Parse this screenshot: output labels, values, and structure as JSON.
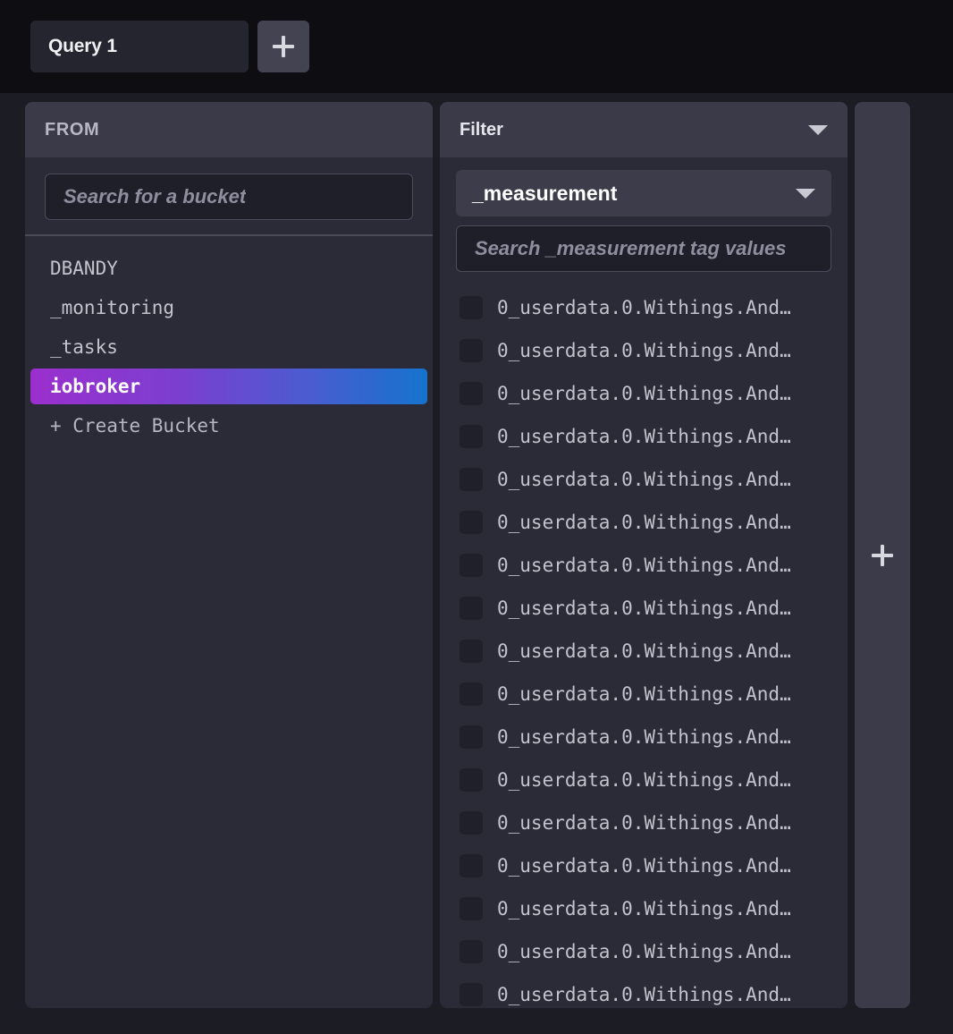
{
  "tabbar": {
    "query_tab_label": "Query 1",
    "add_query_icon": "plus-icon"
  },
  "from_panel": {
    "title": "FROM",
    "search_placeholder": "Search for a bucket",
    "buckets": [
      {
        "label": "DBANDY",
        "selected": false
      },
      {
        "label": "_monitoring",
        "selected": false
      },
      {
        "label": "_tasks",
        "selected": false
      },
      {
        "label": "iobroker",
        "selected": true
      }
    ],
    "create_bucket_label": "+ Create Bucket",
    "selected_gradient_from": "#9b2fce",
    "selected_gradient_to": "#1573ce"
  },
  "filter_panel": {
    "title": "Filter",
    "header_caret_icon": "chevron-down-icon",
    "tag_key": "_measurement",
    "tag_key_caret_icon": "chevron-down-icon",
    "tag_search_placeholder": "Search _measurement tag values",
    "tag_values": [
      {
        "label": "0_userdata.0.Withings.And…",
        "checked": false
      },
      {
        "label": "0_userdata.0.Withings.And…",
        "checked": false
      },
      {
        "label": "0_userdata.0.Withings.And…",
        "checked": false
      },
      {
        "label": "0_userdata.0.Withings.And…",
        "checked": false
      },
      {
        "label": "0_userdata.0.Withings.And…",
        "checked": false
      },
      {
        "label": "0_userdata.0.Withings.And…",
        "checked": false
      },
      {
        "label": "0_userdata.0.Withings.And…",
        "checked": false
      },
      {
        "label": "0_userdata.0.Withings.And…",
        "checked": false
      },
      {
        "label": "0_userdata.0.Withings.And…",
        "checked": false
      },
      {
        "label": "0_userdata.0.Withings.And…",
        "checked": false
      },
      {
        "label": "0_userdata.0.Withings.And…",
        "checked": false
      },
      {
        "label": "0_userdata.0.Withings.And…",
        "checked": false
      },
      {
        "label": "0_userdata.0.Withings.And…",
        "checked": false
      },
      {
        "label": "0_userdata.0.Withings.And…",
        "checked": false
      },
      {
        "label": "0_userdata.0.Withings.And…",
        "checked": false
      },
      {
        "label": "0_userdata.0.Withings.And…",
        "checked": false
      },
      {
        "label": "0_userdata.0.Withings.And…",
        "checked": false
      }
    ]
  },
  "add_card": {
    "icon": "plus-icon"
  }
}
